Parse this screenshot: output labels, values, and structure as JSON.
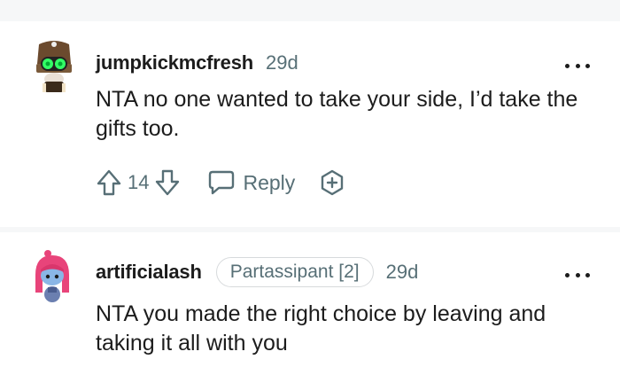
{
  "comments": [
    {
      "username": "jumpkickmcfresh",
      "time": "29d",
      "text": "NTA no one wanted to take your side, I’d take the gifts too.",
      "votes": "14",
      "reply_label": "Reply",
      "avatar_icon": "snoo-avatar-goggles-icon"
    },
    {
      "username": "artificialash",
      "flair": "Partassipant [2]",
      "time": "29d",
      "text": "NTA you made the right choice by leaving and taking it all with you",
      "avatar_icon": "snoo-avatar-pink-hair-icon"
    }
  ],
  "colors": {
    "meta": "#576f76",
    "text": "#1c1c1c",
    "border": "#d7dadc",
    "background": "#f6f7f8"
  },
  "icons": [
    "upvote-icon",
    "downvote-icon",
    "reply-icon",
    "award-icon",
    "more-options-icon"
  ]
}
